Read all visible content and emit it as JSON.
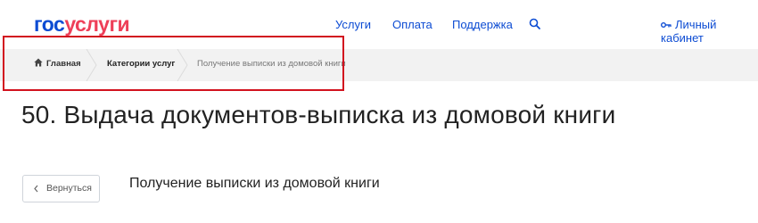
{
  "header": {
    "logo_part1": "гос",
    "logo_part2": "услуги",
    "nav": {
      "services": "Услуги",
      "payment": "Оплата",
      "support": "Поддержка"
    },
    "search_icon": "search-icon",
    "account_label": "Личный кабинет",
    "account_icon": "key-icon"
  },
  "breadcrumb": {
    "home": "Главная",
    "categories": "Категории услуг",
    "current": "Получение выписки из домовой книги"
  },
  "main": {
    "title": "50. Выдача документов-выписка из домовой книги",
    "back_label": "Вернуться",
    "subtitle": "Получение выписки из домовой книги"
  },
  "colors": {
    "brand_blue": "#0d4cd3",
    "brand_red": "#ee3f58",
    "highlight_red": "#d2121f",
    "breadcrumb_bg": "#f2f2f2"
  }
}
